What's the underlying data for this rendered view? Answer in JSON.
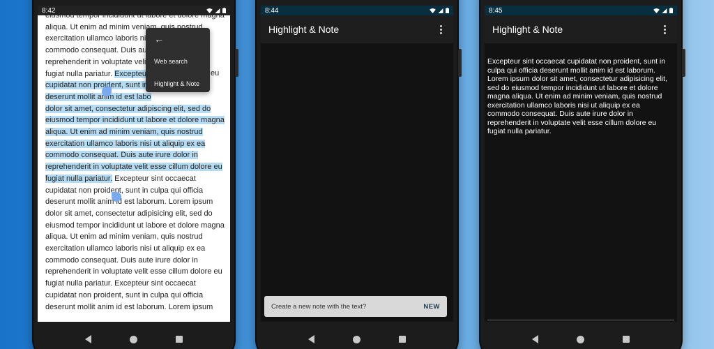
{
  "phones": [
    {
      "status": {
        "time": "8:42"
      },
      "reader": {
        "lines": [
          "eiusmod tempor incididunt ut labore et dolore magna",
          "aliqua. Ut enim ad minim veniam, quis nostrud",
          "exercitation ullamco laboris nisi ut aliquip ex ea",
          "commodo consequat. Duis aut",
          "reprehenderit in voluptate velit",
          "fugiat nulla pariatur. Excepteur",
          "cupidatat non proident, sunt in",
          "deserunt mollit anim id est labo",
          "dolor sit amet, consectetur adipiscing elit, sed do",
          "eiusmod tempor incididunt ut labore et dolore magna",
          "aliqua. Ut enim ad minim veniam, quis nostrud",
          "exercitation ullamco laboris nisi ut aliquip ex ea",
          "commodo consequat. Duis aute irure dolor in",
          "reprehenderit in voluptate velit esse cillum dolore eu",
          "fugiat nulla pariatur. Excepteur sint occaecat",
          "cupidatat non proident, sunt in culpa qui officia",
          "deserunt mollit anim id est laborum. Lorem ipsum",
          "dolor sit amet, consectetur adipisicing elit, sed do",
          "eiusmod tempor incididunt ut labore et dolore magna",
          "aliqua. Ut enim ad minim veniam, quis nostrud",
          "exercitation ullamco laboris nisi ut aliquip ex ea",
          "commodo consequat. Duis aute irure dolor in",
          "reprehenderit in voluptate velit esse cillum dolore eu",
          "fugiat nulla pariatur. Excepteur sint occaecat",
          "cupidatat non proident, sunt in culpa qui officia",
          "deserunt mollit anim id est laborum. Lorem ipsum"
        ]
      },
      "menu": {
        "items": [
          "Web search",
          "Highlight & Note"
        ]
      },
      "menu_tail": [
        "eu",
        "",
        "lore",
        "",
        "ed do"
      ]
    },
    {
      "status": {
        "time": "8:44"
      },
      "appbar": {
        "title": "Highlight & Note"
      },
      "snackbar": {
        "text": "Create a new note with the text?",
        "action": "NEW"
      }
    },
    {
      "status": {
        "time": "8:45"
      },
      "appbar": {
        "title": "Highlight & Note"
      },
      "note": {
        "lines": [
          "Excepteur sint occaecat cupidatat non proident, sunt in",
          "culpa qui officia deserunt mollit anim id est laborum.",
          "Lorem ipsum dolor sit amet, consectetur adipisicing elit,",
          "sed do eiusmod tempor incididunt ut labore et dolore",
          "magna aliqua. Ut enim ad minim veniam, quis nostrud",
          "exercitation ullamco laboris nisi ut aliquip ex ea",
          "commodo consequat. Duis aute irure dolor in",
          "reprehenderit in voluptate velit esse cillum dolore eu",
          "fugiat nulla pariatur."
        ]
      }
    }
  ],
  "colors": {
    "highlight": "#b6dcf3",
    "handle": "#7aa9ee",
    "note_bg": "#121212",
    "snackbar": "#d9d9d9"
  }
}
